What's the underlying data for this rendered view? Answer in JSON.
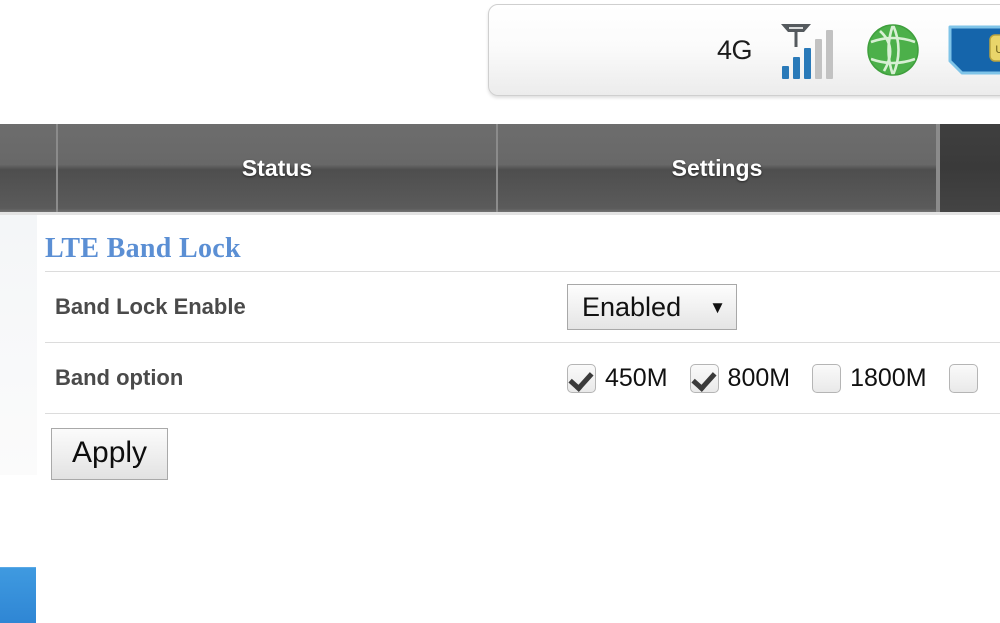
{
  "status_bar": {
    "network_label": "4G",
    "icons": [
      {
        "name": "signal-strength-icon",
        "bars_total": 5,
        "bars_active": 3,
        "active_color": "#2a7ab9",
        "inactive_color": "#c2c2c2"
      },
      {
        "name": "network-globe-icon",
        "color": "#4cb04a"
      },
      {
        "name": "sim-card-icon",
        "color": "#1565ab",
        "chip_color": "#e9d56a",
        "chip_label": "US"
      }
    ]
  },
  "nav": {
    "tabs": [
      {
        "label": "",
        "name": "nav-tab-left-edge",
        "state": "inactive"
      },
      {
        "label": "Status",
        "name": "nav-tab-status",
        "state": "inactive"
      },
      {
        "label": "Settings",
        "name": "nav-tab-settings",
        "state": "inactive"
      },
      {
        "label": "",
        "name": "nav-tab-right",
        "state": "active"
      }
    ]
  },
  "sidebar": {
    "active_item_color": "#2f86d4"
  },
  "content": {
    "title": "LTE Band Lock",
    "rows": [
      {
        "label": "Band Lock Enable",
        "control": "select",
        "value": "Enabled",
        "caret": "▼"
      },
      {
        "label": "Band option",
        "control": "checkbox-group",
        "options": [
          {
            "label": "450M",
            "checked": true
          },
          {
            "label": "800M",
            "checked": true
          },
          {
            "label": "1800M",
            "checked": false
          },
          {
            "label": "",
            "checked": false
          }
        ]
      }
    ],
    "apply_label": "Apply"
  },
  "colors": {
    "title_blue": "#5b8fd4",
    "accent_blue": "#2f86d4",
    "nav_gray": "#5b5b5b",
    "nav_active_gray": "#3f3f3f"
  }
}
